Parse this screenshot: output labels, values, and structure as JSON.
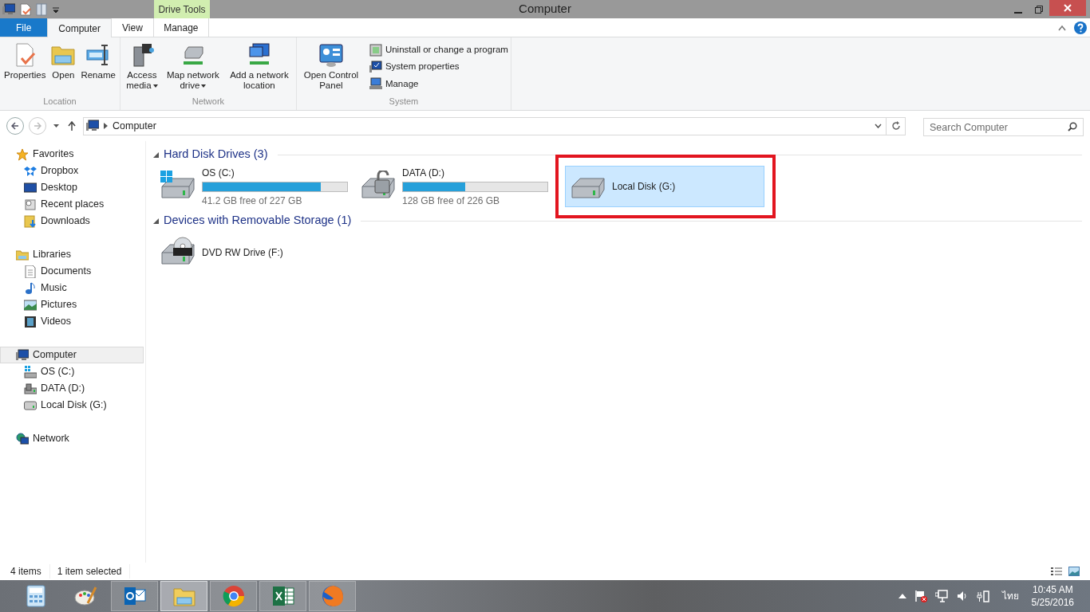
{
  "window": {
    "title": "Computer",
    "contextual_tab_group": "Drive Tools"
  },
  "tabs": [
    {
      "label": "File",
      "kind": "file",
      "selected": false
    },
    {
      "label": "Computer",
      "kind": "tab",
      "selected": true
    },
    {
      "label": "View",
      "kind": "tab",
      "selected": false
    },
    {
      "label": "Manage",
      "kind": "tab",
      "selected": false
    }
  ],
  "ribbon": {
    "groups": [
      {
        "label": "Location",
        "items": [
          {
            "label": "Properties",
            "kind": "large"
          },
          {
            "label": "Open",
            "kind": "large"
          },
          {
            "label": "Rename",
            "kind": "large"
          }
        ]
      },
      {
        "label": "Network",
        "items": [
          {
            "label": "Access media",
            "kind": "large",
            "dropdown": true
          },
          {
            "label": "Map network drive",
            "kind": "large",
            "dropdown": true
          },
          {
            "label": "Add a network location",
            "kind": "large"
          }
        ]
      },
      {
        "label": "System",
        "items": [
          {
            "label": "Open Control Panel",
            "kind": "large"
          },
          {
            "label": "Uninstall or change a program",
            "kind": "small"
          },
          {
            "label": "System properties",
            "kind": "small"
          },
          {
            "label": "Manage",
            "kind": "small"
          }
        ]
      }
    ]
  },
  "address_bar": {
    "path": [
      "Computer"
    ],
    "search_placeholder": "Search Computer"
  },
  "navigation_pane": [
    {
      "label": "Favorites",
      "selected": false,
      "children": [
        {
          "label": "Dropbox",
          "selected": false
        },
        {
          "label": "Desktop",
          "selected": false
        },
        {
          "label": "Recent places",
          "selected": false
        },
        {
          "label": "Downloads",
          "selected": false
        }
      ]
    },
    {
      "label": "Libraries",
      "selected": false,
      "children": [
        {
          "label": "Documents",
          "selected": false
        },
        {
          "label": "Music",
          "selected": false
        },
        {
          "label": "Pictures",
          "selected": false
        },
        {
          "label": "Videos",
          "selected": false
        }
      ]
    },
    {
      "label": "Computer",
      "selected": true,
      "children": [
        {
          "label": "OS (C:)",
          "selected": false
        },
        {
          "label": "DATA (D:)",
          "selected": false
        },
        {
          "label": "Local Disk (G:)",
          "selected": false
        }
      ]
    },
    {
      "label": "Network",
      "selected": false
    }
  ],
  "sections": [
    {
      "title": "Hard Disk Drives (3)",
      "expanded": true,
      "drives": [
        {
          "name": "OS (C:)",
          "level": 0.82,
          "free": "41.2 GB free of 227 GB",
          "selected": false,
          "highlighted": false
        },
        {
          "name": "DATA (D:)",
          "level": 0.43,
          "free": "128 GB free of 226 GB",
          "selected": false,
          "highlighted": false
        },
        {
          "name": "Local Disk (G:)",
          "selected": true,
          "highlighted": true
        }
      ]
    },
    {
      "title": "Devices with Removable Storage (1)",
      "expanded": true,
      "drives": [
        {
          "name": "DVD RW Drive (F:)",
          "selected": false,
          "highlighted": false
        }
      ]
    }
  ],
  "status_bar": {
    "item_count": "4 items",
    "selection": "1 item selected"
  },
  "taskbar": {
    "apps": [
      {
        "running": false,
        "active": false
      },
      {
        "running": false,
        "active": false
      },
      {
        "running": true,
        "active": false
      },
      {
        "running": true,
        "active": true
      },
      {
        "running": true,
        "active": false
      },
      {
        "running": true,
        "active": false
      },
      {
        "running": true,
        "active": false
      }
    ],
    "language": "ไทย",
    "time": "10:45 AM",
    "date": "5/25/2016"
  }
}
